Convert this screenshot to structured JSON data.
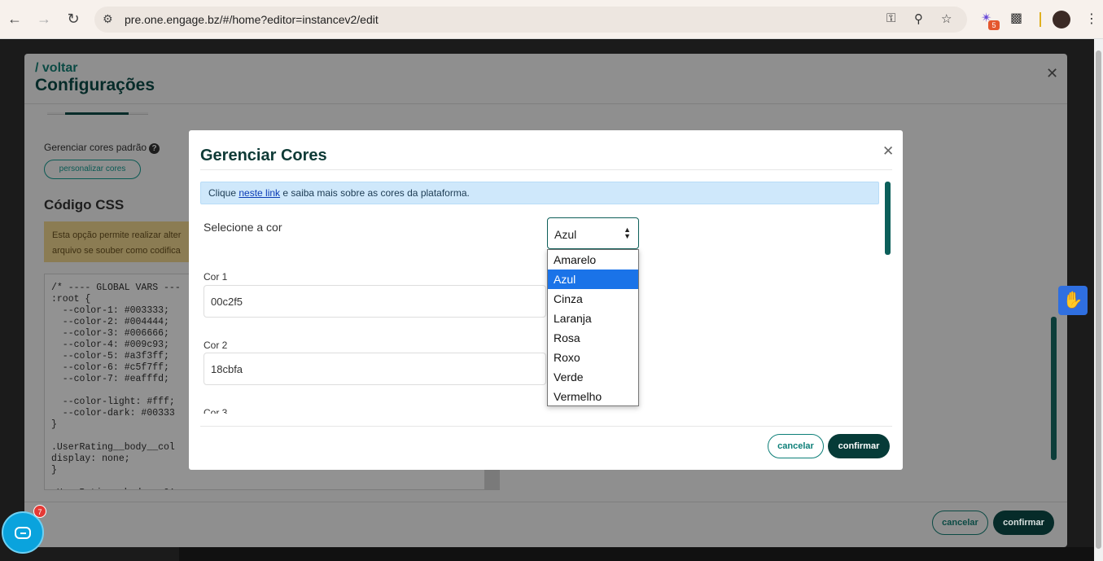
{
  "browser": {
    "url": "pre.one.engage.bz/#/home?editor=instancev2/edit",
    "extension_badge": "5"
  },
  "config": {
    "back_label": "/ voltar",
    "title": "Configurações",
    "manage_label": "Gerenciar cores padrão",
    "personalize_label": "personalizar cores",
    "css_title": "Código CSS",
    "warning_text": "Esta opção permite realizar alter\narquivo se souber como codifica",
    "code": "/* ---- GLOBAL VARS ---\n:root {\n  --color-1: #003333;\n  --color-2: #004444;\n  --color-3: #006666;\n  --color-4: #009c93;\n  --color-5: #a3f3ff;\n  --color-6: #c5f7ff;\n  --color-7: #eafffd;\n\n  --color-light: #fff;\n  --color-dark: #00333\n}\n\n.UserRating__body__col\ndisplay: none;\n}\n\n.UserRating__body__c01",
    "cancel_label": "cancelar",
    "confirm_label": "confirmar"
  },
  "modal": {
    "title": "Gerenciar Cores",
    "info_prefix": "Clique ",
    "info_link": "neste link",
    "info_suffix": " e saiba mais sobre as cores da plataforma.",
    "select_label": "Selecione a cor",
    "selected_color": "Azul",
    "fields": [
      {
        "label": "Cor 1",
        "value": "00c2f5"
      },
      {
        "label": "Cor 2",
        "value": "18cbfa"
      }
    ],
    "clipped_label": "Cor 3",
    "cancel_label": "cancelar",
    "confirm_label": "confirmar"
  },
  "dropdown": {
    "options": [
      "Amarelo",
      "Azul",
      "Cinza",
      "Laranja",
      "Rosa",
      "Roxo",
      "Verde",
      "Vermelho"
    ],
    "selected_index": 1
  },
  "chat": {
    "badge": "7"
  },
  "colors": {
    "primary": "#063b38",
    "accent": "#0d7f78",
    "info_bg": "#cfe8fb",
    "dropdown_selected": "#1a73e8"
  }
}
